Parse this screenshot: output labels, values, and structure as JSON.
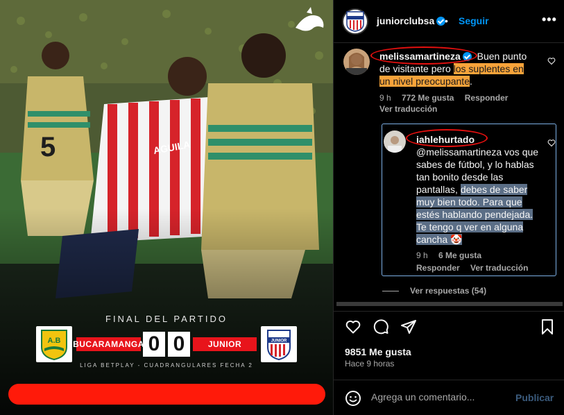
{
  "media": {
    "title": "FINAL DEL PARTIDO",
    "home_team": "BUCARAMANGA",
    "away_team": "JUNIOR",
    "home_score": "0",
    "away_score": "0",
    "league": "LIGA BETPLAY - CUADRANGULARES FECHA 2",
    "home_logo_text": "A.B",
    "away_logo_text": "JUNIOR",
    "jersey_sponsor": "AGUILA",
    "jersey_number": "5"
  },
  "header": {
    "username": "juniorclubsa",
    "follow_label": "Seguir",
    "separator": "•",
    "more_label": "•••",
    "avatar_text": "JUNIOR"
  },
  "comment": {
    "username": "melissamartineza",
    "text_plain": "Buen punto de visitante pero ",
    "text_highlight": "los suplentes en un nivel preocupante",
    "text_end": ".",
    "time": "9 h",
    "likes": "772 Me gusta",
    "reply_label": "Responder",
    "translate_label": "Ver traducción"
  },
  "reply": {
    "username": "iahlehurtado",
    "text_plain": "@melissamartineza vos que sabes de fútbol, y lo hablas tan bonito desde las pantallas, ",
    "text_highlight": "debes de saber muy bien todo. Para que estés hablando pendejada. Te tengo q ver en alguna cancha 🤡",
    "time": "9 h",
    "likes": "6 Me gusta",
    "reply_label": "Responder",
    "translate_label": "Ver traducción"
  },
  "view_replies": "Ver respuestas (54)",
  "post": {
    "likes": "9851 Me gusta",
    "time_ago": "Hace 9 horas"
  },
  "composer": {
    "placeholder": "Agrega un comentario...",
    "publish_label": "Publicar"
  },
  "colors": {
    "link_blue": "#0095f6",
    "highlight_orange": "#f7a33a",
    "highlight_blue": "#5b6e86",
    "annotation_red": "#e3100f",
    "score_red": "#e8141b"
  }
}
